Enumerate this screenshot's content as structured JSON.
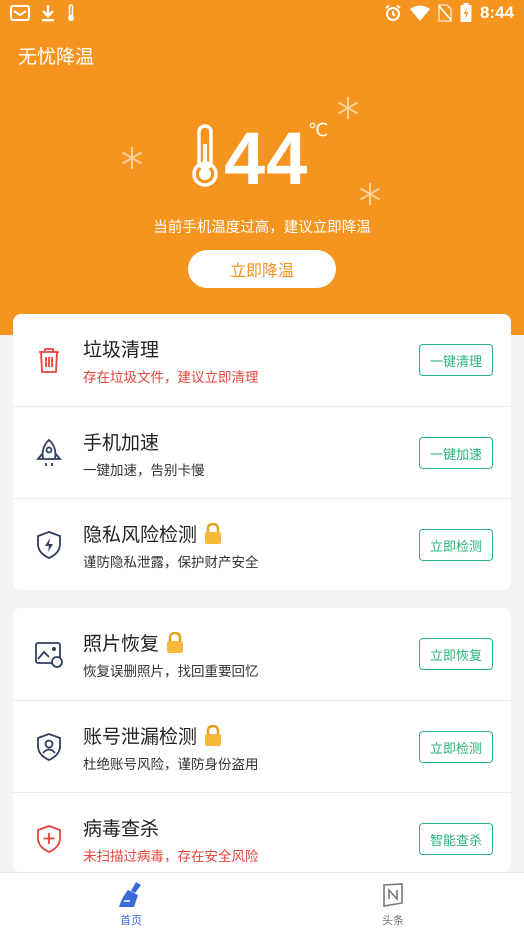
{
  "status_bar": {
    "time": "8:44"
  },
  "app": {
    "title": "无忧降温"
  },
  "temperature": {
    "value": "44",
    "unit": "℃",
    "message": "当前手机温度过高，建议立即降温",
    "button_label": "立即降温"
  },
  "features_group1": [
    {
      "icon": "trash-icon",
      "title": "垃圾清理",
      "locked": false,
      "subtitle": "存在垃圾文件，建议立即清理",
      "warning": true,
      "action": "一键清理"
    },
    {
      "icon": "rocket-icon",
      "title": "手机加速",
      "locked": false,
      "subtitle": "一键加速，告别卡慢",
      "warning": false,
      "action": "一键加速"
    },
    {
      "icon": "shield-bolt-icon",
      "title": "隐私风险检测",
      "locked": true,
      "subtitle": "谨防隐私泄露，保护财产安全",
      "warning": false,
      "action": "立即检测"
    }
  ],
  "features_group2": [
    {
      "icon": "photo-restore-icon",
      "title": "照片恢复",
      "locked": true,
      "subtitle": "恢复误删照片，找回重要回忆",
      "warning": false,
      "action": "立即恢复"
    },
    {
      "icon": "account-shield-icon",
      "title": "账号泄漏检测",
      "locked": true,
      "subtitle": "杜绝账号风险，谨防身份盗用",
      "warning": false,
      "action": "立即检测"
    },
    {
      "icon": "virus-shield-icon",
      "title": "病毒查杀",
      "locked": false,
      "subtitle": "未扫描过病毒，存在安全风险",
      "warning": true,
      "action": "智能查杀"
    }
  ],
  "tabs": [
    {
      "label": "首页",
      "icon": "broom-icon",
      "active": true
    },
    {
      "label": "头条",
      "icon": "news-icon",
      "active": false
    }
  ],
  "colors": {
    "header": "#f5951f",
    "accent_green": "#27b37a",
    "warning_red": "#e3463c",
    "active_tab": "#3a6ad8"
  }
}
